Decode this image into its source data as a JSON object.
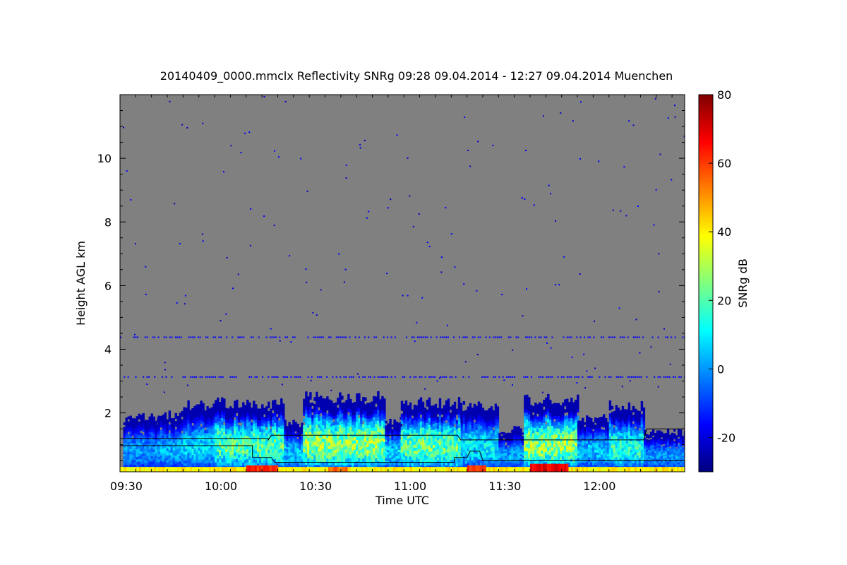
{
  "chart_data": {
    "type": "heatmap",
    "title": "20140409_0000.mmclx Reflectivity SNRg   09:28 09.04.2014 - 12:27 09.04.2014 Muenchen",
    "xlabel": "Time UTC",
    "ylabel": "Height AGL km",
    "colorbar_label": "SNRg dB",
    "x_tick_labels": [
      "09:30",
      "10:00",
      "10:30",
      "11:00",
      "11:30",
      "12:00"
    ],
    "x_tick_minutes": [
      2,
      32,
      62,
      92,
      122,
      152
    ],
    "xlim_minutes": [
      0,
      179
    ],
    "y_ticks": [
      2,
      4,
      6,
      8,
      10
    ],
    "ylim": [
      0.15,
      12.0
    ],
    "colorbar_ticks": [
      -20,
      0,
      20,
      40,
      60,
      80
    ],
    "colorbar_range": [
      -30,
      80
    ],
    "background_color": "#808080",
    "colormap": [
      "#00007f",
      "#0000ff",
      "#007fff",
      "#00ffff",
      "#7fff7f",
      "#ffff00",
      "#ff7f00",
      "#ff0000",
      "#7f0000"
    ],
    "cloud_layers": [
      {
        "t_start": 1,
        "t_end": 12,
        "top": 2.0,
        "peak_snr": 5
      },
      {
        "t_start": 12,
        "t_end": 20,
        "top": 2.1,
        "peak_snr": 8
      },
      {
        "t_start": 20,
        "t_end": 30,
        "top": 2.4,
        "peak_snr": 12
      },
      {
        "t_start": 30,
        "t_end": 52,
        "top": 2.5,
        "peak_snr": 28
      },
      {
        "t_start": 52,
        "t_end": 58,
        "top": 1.8,
        "peak_snr": 10
      },
      {
        "t_start": 58,
        "t_end": 84,
        "top": 2.7,
        "peak_snr": 35
      },
      {
        "t_start": 84,
        "t_end": 89,
        "top": 1.9,
        "peak_snr": 12
      },
      {
        "t_start": 89,
        "t_end": 108,
        "top": 2.5,
        "peak_snr": 30
      },
      {
        "t_start": 108,
        "t_end": 120,
        "top": 2.4,
        "peak_snr": 15
      },
      {
        "t_start": 120,
        "t_end": 128,
        "top": 1.6,
        "peak_snr": 6
      },
      {
        "t_start": 128,
        "t_end": 145,
        "top": 2.6,
        "peak_snr": 35
      },
      {
        "t_start": 145,
        "t_end": 155,
        "top": 2.0,
        "peak_snr": 10
      },
      {
        "t_start": 155,
        "t_end": 166,
        "top": 2.4,
        "peak_snr": 22
      },
      {
        "t_start": 166,
        "t_end": 179,
        "top": 1.5,
        "peak_snr": 4
      }
    ],
    "echo_lines": [
      3.15,
      4.4
    ],
    "near_surface_bands": [
      {
        "t_start": 0,
        "t_end": 179,
        "h0": 0.15,
        "h1": 0.3,
        "snr": 40
      },
      {
        "t_start": 40,
        "t_end": 50,
        "h0": 0.15,
        "h1": 0.35,
        "snr": 62
      },
      {
        "t_start": 66,
        "t_end": 72,
        "h0": 0.15,
        "h1": 0.3,
        "snr": 55
      },
      {
        "t_start": 110,
        "t_end": 116,
        "h0": 0.15,
        "h1": 0.35,
        "snr": 62
      },
      {
        "t_start": 130,
        "t_end": 142,
        "h0": 0.15,
        "h1": 0.4,
        "snr": 68
      }
    ],
    "boundary_layer_lines": [
      {
        "points": [
          [
            0,
            1.2
          ],
          [
            47,
            1.2
          ],
          [
            47,
            1.15
          ],
          [
            48,
            1.3
          ],
          [
            107,
            1.3
          ],
          [
            108,
            1.15
          ],
          [
            166,
            1.15
          ],
          [
            167,
            1.5
          ],
          [
            179,
            1.5
          ]
        ]
      },
      {
        "points": [
          [
            0,
            0.97
          ],
          [
            42,
            0.97
          ],
          [
            42,
            0.6
          ],
          [
            48,
            0.6
          ],
          [
            49,
            0.45
          ],
          [
            106,
            0.45
          ],
          [
            106,
            0.6
          ],
          [
            110,
            0.6
          ],
          [
            111,
            0.8
          ],
          [
            114,
            0.8
          ],
          [
            115,
            0.5
          ],
          [
            179,
            0.5
          ]
        ]
      }
    ]
  }
}
